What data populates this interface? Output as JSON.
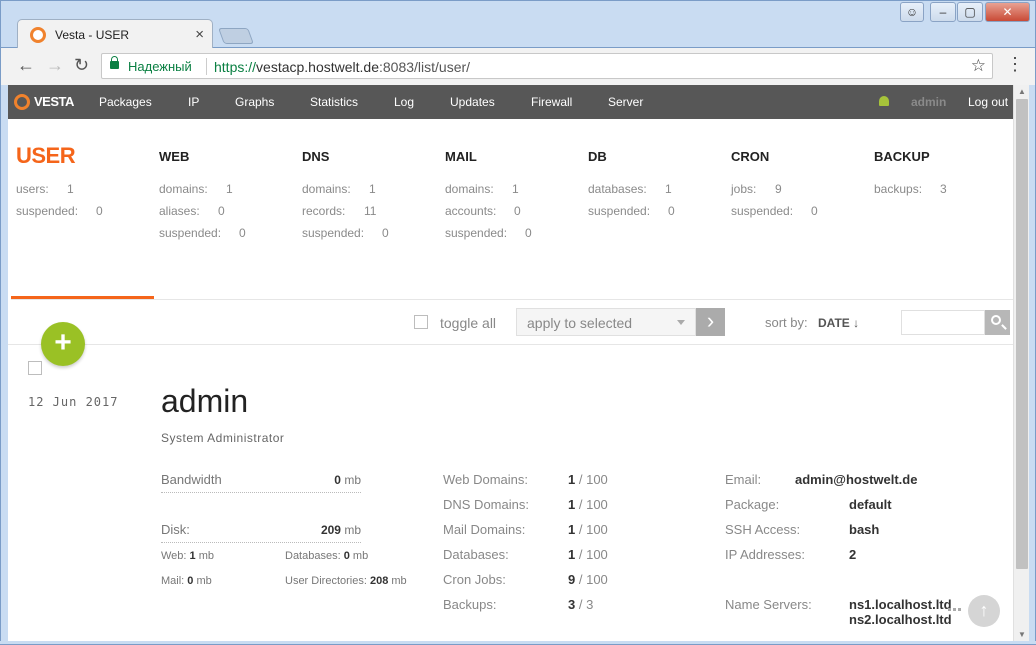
{
  "browser": {
    "tab_title": "Vesta - USER",
    "secure_label": "Надежный",
    "url_scheme": "https://",
    "url_host": "vestacp.hostwelt.de",
    "url_path": ":8083/list/user/"
  },
  "nav": {
    "logo": "VESTA",
    "items": [
      "Packages",
      "IP",
      "Graphs",
      "Statistics",
      "Log",
      "Updates",
      "Firewall",
      "Server"
    ],
    "user": "admin",
    "logout": "Log out"
  },
  "stats": {
    "user": {
      "title": "USER",
      "rows": [
        [
          "users:",
          "1"
        ],
        [
          "suspended:",
          "0"
        ]
      ]
    },
    "web": {
      "title": "WEB",
      "rows": [
        [
          "domains:",
          "1"
        ],
        [
          "aliases:",
          "0"
        ],
        [
          "suspended:",
          "0"
        ]
      ]
    },
    "dns": {
      "title": "DNS",
      "rows": [
        [
          "domains:",
          "1"
        ],
        [
          "records:",
          "11"
        ],
        [
          "suspended:",
          "0"
        ]
      ]
    },
    "mail": {
      "title": "MAIL",
      "rows": [
        [
          "domains:",
          "1"
        ],
        [
          "accounts:",
          "0"
        ],
        [
          "suspended:",
          "0"
        ]
      ]
    },
    "db": {
      "title": "DB",
      "rows": [
        [
          "databases:",
          "1"
        ],
        [
          "suspended:",
          "0"
        ]
      ]
    },
    "cron": {
      "title": "CRON",
      "rows": [
        [
          "jobs:",
          "9"
        ],
        [
          "suspended:",
          "0"
        ]
      ]
    },
    "backup": {
      "title": "BACKUP",
      "rows": [
        [
          "backups:",
          "3"
        ]
      ]
    }
  },
  "toolbar": {
    "toggle_all": "toggle all",
    "apply_placeholder": "apply to selected",
    "sort_label": "sort by:",
    "sort_value": "DATE ↓"
  },
  "user_entry": {
    "date": "12 Jun 2017",
    "name": "admin",
    "role": "System Administrator",
    "bandwidth_label": "Bandwidth",
    "bandwidth_value": "0",
    "bandwidth_unit": "mb",
    "disk_label": "Disk:",
    "disk_value": "209",
    "disk_unit": "mb",
    "web_usage": {
      "label": "Web:",
      "value": "1",
      "unit": "mb"
    },
    "db_usage": {
      "label": "Databases:",
      "value": "0",
      "unit": "mb"
    },
    "mail_usage": {
      "label": "Mail:",
      "value": "0",
      "unit": "mb"
    },
    "udir_usage": {
      "label": "User Directories:",
      "value": "208",
      "unit": "mb"
    },
    "limits": [
      {
        "label": "Web Domains:",
        "used": "1",
        "max": "/ 100"
      },
      {
        "label": "DNS Domains:",
        "used": "1",
        "max": "/ 100"
      },
      {
        "label": "Mail Domains:",
        "used": "1",
        "max": "/ 100"
      },
      {
        "label": "Databases:",
        "used": "1",
        "max": "/ 100"
      },
      {
        "label": "Cron Jobs:",
        "used": "9",
        "max": "/ 100"
      },
      {
        "label": "Backups:",
        "used": "3",
        "max": "/ 3"
      }
    ],
    "info": {
      "email_label": "Email:",
      "email": "admin@hostwelt.de",
      "package_label": "Package:",
      "package": "default",
      "ssh_label": "SSH Access:",
      "ssh": "bash",
      "ip_label": "IP Addresses:",
      "ip": "2",
      "ns_label": "Name Servers:",
      "ns1": "ns1.localhost.ltd",
      "ns2": "ns2.localhost.ltd"
    }
  },
  "colors": {
    "accent": "#f5651a",
    "add": "#9ac125",
    "nav_bg": "#575757"
  }
}
